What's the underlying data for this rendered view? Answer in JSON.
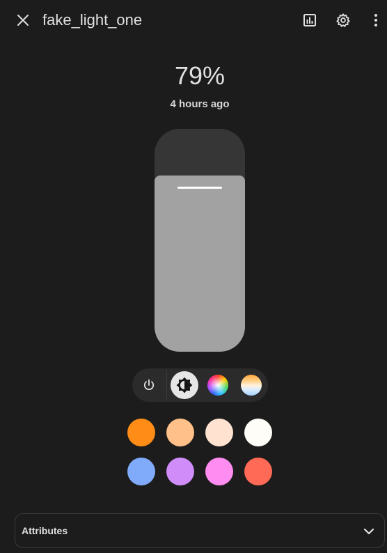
{
  "header": {
    "title": "fake_light_one",
    "icons": {
      "close": "close-icon",
      "history": "chart-bar-icon",
      "settings": "gear-icon",
      "more": "dots-vertical-icon"
    }
  },
  "state": {
    "brightness_text": "79%",
    "brightness_level": 79,
    "last_changed": "4 hours ago"
  },
  "modes": [
    {
      "name": "power",
      "icon": "power-icon",
      "active": false
    },
    {
      "name": "brightness",
      "icon": "brightness-icon",
      "active": true
    },
    {
      "name": "color",
      "icon": "color-wheel-icon",
      "active": false
    },
    {
      "name": "color-temperature",
      "icon": "color-temperature-icon",
      "active": false
    }
  ],
  "presets": {
    "row1": [
      "#ff8c17",
      "#ffc08a",
      "#ffe2cf",
      "#fffdf7"
    ],
    "row2": [
      "#7fabfa",
      "#d08dfa",
      "#ff8cf0",
      "#fe6a55"
    ]
  },
  "colors": {
    "background": "#1c1c1c",
    "slider_track": "#363636",
    "slider_fill": "#a2a2a2",
    "text": "#e1e1e1"
  },
  "attributes": {
    "label": "Attributes"
  }
}
